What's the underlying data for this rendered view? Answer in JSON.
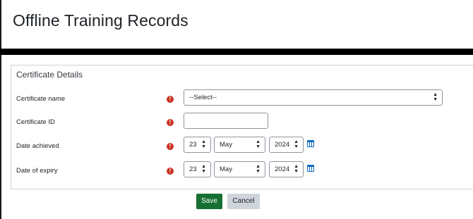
{
  "header": {
    "title": "Offline Training Records"
  },
  "form": {
    "section_title": "Certificate Details",
    "required_symbol": "!",
    "fields": {
      "certificate_name": {
        "label": "Certificate name",
        "value": "--Select--"
      },
      "certificate_id": {
        "label": "Certificate ID",
        "value": ""
      },
      "date_achieved": {
        "label": "Date achieved",
        "day": "23",
        "month": "May",
        "year": "2024"
      },
      "date_of_expiry": {
        "label": "Date of expiry",
        "day": "23",
        "month": "May",
        "year": "2024"
      }
    },
    "icons": {
      "required": "exclamation-circle-icon",
      "calendar": "calendar-icon",
      "select_arrows": "up-down-arrows-icon"
    }
  },
  "actions": {
    "save_label": "Save",
    "cancel_label": "Cancel"
  },
  "colors": {
    "required": "#ca3120",
    "save_button": "#177033",
    "cancel_button": "#ced4da",
    "calendar_icon": "#0f6cbf"
  }
}
